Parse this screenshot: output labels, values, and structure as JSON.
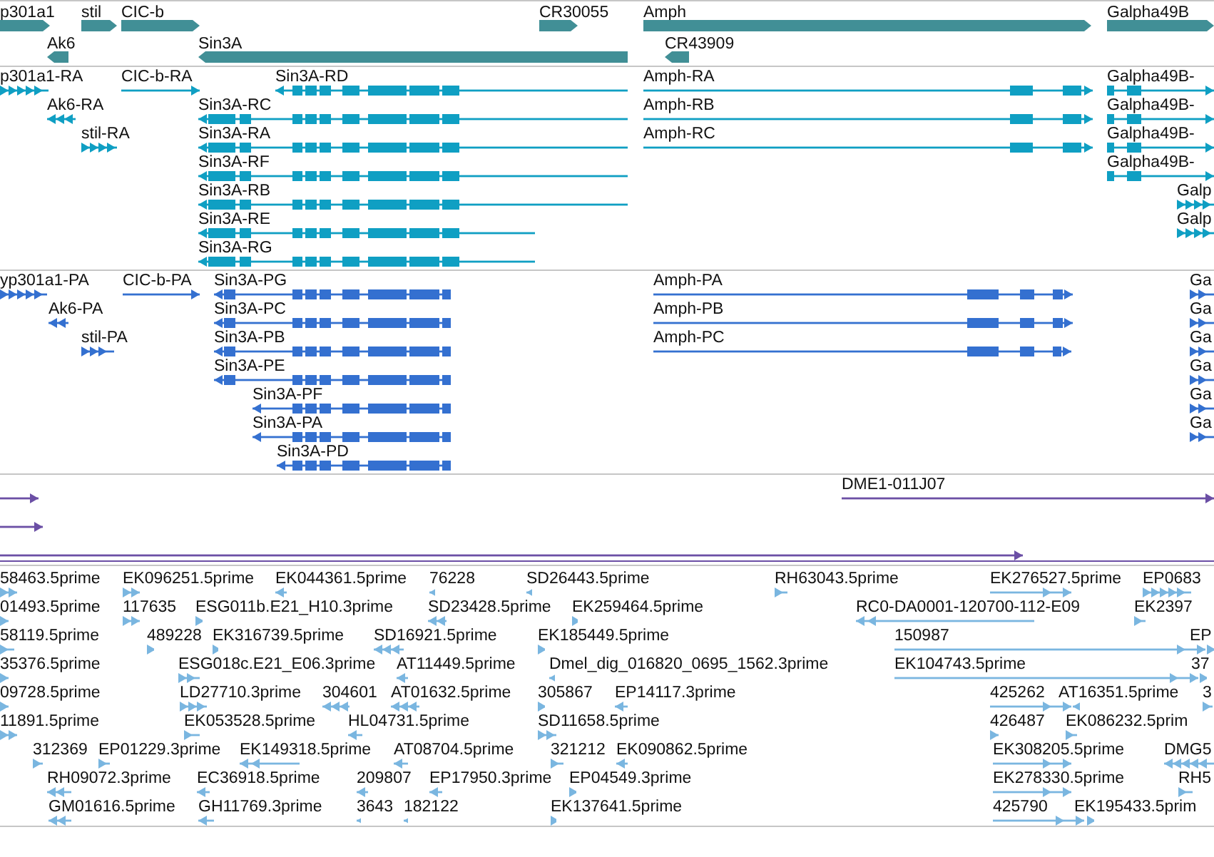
{
  "tracks": [
    {
      "kind": "gene",
      "color": "#418f96",
      "features": [
        {
          "label": "p301a1",
          "reverse": false
        },
        {
          "label": "stil",
          "reverse": false
        },
        {
          "label": "CIC-b",
          "reverse": false
        },
        {
          "label": "CR30055",
          "reverse": false
        },
        {
          "label": "Amph",
          "reverse": false
        },
        {
          "label": "Galpha49B",
          "reverse": false
        },
        {
          "label": "Ak6",
          "reverse": true
        },
        {
          "label": "Sin3A",
          "reverse": true
        },
        {
          "label": "CR43909",
          "reverse": true
        }
      ]
    },
    {
      "kind": "transcript",
      "color": "#0f9fc3",
      "features": [
        {
          "label": "p301a1-RA",
          "reverse": false
        },
        {
          "label": "CIC-b-RA",
          "reverse": false
        },
        {
          "label": "Sin3A-RD",
          "reverse": true
        },
        {
          "label": "Amph-RA",
          "reverse": false
        },
        {
          "label": "Galpha49B-",
          "reverse": false
        },
        {
          "label": "Ak6-RA",
          "reverse": true
        },
        {
          "label": "Sin3A-RC",
          "reverse": true
        },
        {
          "label": "Amph-RB",
          "reverse": false
        },
        {
          "label": "Galpha49B-",
          "reverse": false
        },
        {
          "label": "stil-RA",
          "reverse": false
        },
        {
          "label": "Sin3A-RA",
          "reverse": true
        },
        {
          "label": "Amph-RC",
          "reverse": false
        },
        {
          "label": "Galpha49B-",
          "reverse": false
        },
        {
          "label": "Sin3A-RF",
          "reverse": true
        },
        {
          "label": "Galpha49B-",
          "reverse": false
        },
        {
          "label": "Sin3A-RB",
          "reverse": true
        },
        {
          "label": "Galp",
          "reverse": false
        },
        {
          "label": "Sin3A-RE",
          "reverse": true
        },
        {
          "label": "Galp",
          "reverse": false
        },
        {
          "label": "Sin3A-RG",
          "reverse": true
        }
      ]
    },
    {
      "kind": "protein",
      "color": "#3470d0",
      "features": [
        {
          "label": "yp301a1-PA",
          "reverse": false
        },
        {
          "label": "CIC-b-PA",
          "reverse": false
        },
        {
          "label": "Sin3A-PG",
          "reverse": true
        },
        {
          "label": "Amph-PA",
          "reverse": false
        },
        {
          "label": "Ga",
          "reverse": false
        },
        {
          "label": "Ak6-PA",
          "reverse": true
        },
        {
          "label": "Sin3A-PC",
          "reverse": true
        },
        {
          "label": "Amph-PB",
          "reverse": false
        },
        {
          "label": "Ga",
          "reverse": false
        },
        {
          "label": "stil-PA",
          "reverse": false
        },
        {
          "label": "Sin3A-PB",
          "reverse": true
        },
        {
          "label": "Amph-PC",
          "reverse": false
        },
        {
          "label": "Ga",
          "reverse": false
        },
        {
          "label": "Sin3A-PE",
          "reverse": true
        },
        {
          "label": "Ga",
          "reverse": false
        },
        {
          "label": "Sin3A-PF",
          "reverse": true
        },
        {
          "label": "Ga",
          "reverse": false
        },
        {
          "label": "Sin3A-PA",
          "reverse": true
        },
        {
          "label": "Ga",
          "reverse": false
        },
        {
          "label": "Sin3A-PD",
          "reverse": true
        }
      ]
    },
    {
      "kind": "clone",
      "color": "#6b4fa5",
      "features": [
        {
          "reverse": false
        },
        {
          "label": "DME1-011J07",
          "reverse": false
        },
        {
          "reverse": false
        },
        {
          "reverse": false
        }
      ]
    },
    {
      "kind": "est",
      "color": "#7ab6e0",
      "features": [
        {
          "label": "58463.5prime",
          "reverse": false
        },
        {
          "label": "EK096251.5prime",
          "reverse": false
        },
        {
          "label": "EK044361.5prime",
          "reverse": true
        },
        {
          "label": "76228",
          "reverse": true
        },
        {
          "label": "SD26443.5prime",
          "reverse": true
        },
        {
          "label": "RH63043.5prime",
          "reverse": false
        },
        {
          "label": "EK276527.5prime",
          "reverse": false
        },
        {
          "label": "EP0683",
          "reverse": false
        },
        {
          "label": "01493.5prime",
          "reverse": false
        },
        {
          "label": "117635",
          "reverse": false
        },
        {
          "label": "ESG011b.E21_H10.3prime",
          "reverse": false
        },
        {
          "label": "SD23428.5prime",
          "reverse": true
        },
        {
          "label": "EK259464.5prime",
          "reverse": false
        },
        {
          "label": "RC0-DA0001-120700-112-E09",
          "reverse": true
        },
        {
          "label": "EK2397",
          "reverse": false
        },
        {
          "label": "58119.5prime",
          "reverse": false
        },
        {
          "label": "489228",
          "reverse": false
        },
        {
          "label": "EK316739.5prime",
          "reverse": false
        },
        {
          "label": "SD16921.5prime",
          "reverse": true
        },
        {
          "label": "EK185449.5prime",
          "reverse": false
        },
        {
          "label": "150987",
          "reverse": false
        },
        {
          "label": "EP",
          "reverse": false
        },
        {
          "label": "35376.5prime",
          "reverse": false
        },
        {
          "label": "ESG018c.E21_E06.3prime",
          "reverse": false
        },
        {
          "label": "AT11449.5prime",
          "reverse": true
        },
        {
          "label": "Dmel_dig_016820_0695_1562.3prime",
          "reverse": true
        },
        {
          "label": "EK104743.5prime",
          "reverse": false
        },
        {
          "label": "37",
          "reverse": false
        },
        {
          "label": "09728.5prime",
          "reverse": false
        },
        {
          "label": "LD27710.3prime",
          "reverse": false
        },
        {
          "label": "304601",
          "reverse": true
        },
        {
          "label": "AT01632.5prime",
          "reverse": true
        },
        {
          "label": "305867",
          "reverse": false
        },
        {
          "label": "EP14117.3prime",
          "reverse": true
        },
        {
          "label": "425262",
          "reverse": false
        },
        {
          "label": "AT16351.5prime",
          "reverse": true
        },
        {
          "label": "3",
          "reverse": false
        },
        {
          "label": "11891.5prime",
          "reverse": false
        },
        {
          "label": "EK053528.5prime",
          "reverse": false
        },
        {
          "label": "HL04731.5prime",
          "reverse": true
        },
        {
          "label": "SD11658.5prime",
          "reverse": false
        },
        {
          "label": "426487",
          "reverse": false
        },
        {
          "label": "EK086232.5prim",
          "reverse": false
        },
        {
          "label": "312369",
          "reverse": false
        },
        {
          "label": "EP01229.3prime",
          "reverse": false
        },
        {
          "label": "EK149318.5prime",
          "reverse": true
        },
        {
          "label": "AT08704.5prime",
          "reverse": true
        },
        {
          "label": "321212",
          "reverse": false
        },
        {
          "label": "EK090862.5prime",
          "reverse": true
        },
        {
          "label": "EK308205.5prime",
          "reverse": false
        },
        {
          "label": "DMG5",
          "reverse": true
        },
        {
          "label": "RH09072.3prime",
          "reverse": true
        },
        {
          "label": "EC36918.5prime",
          "reverse": true
        },
        {
          "label": "209807",
          "reverse": true
        },
        {
          "label": "EP17950.3prime",
          "reverse": true
        },
        {
          "label": "EP04549.3prime",
          "reverse": false
        },
        {
          "label": "EK278330.5prime",
          "reverse": false
        },
        {
          "label": "RH5",
          "reverse": false
        },
        {
          "label": "GM01616.5prime",
          "reverse": true
        },
        {
          "label": "GH11769.3prime",
          "reverse": true
        },
        {
          "label": "3643",
          "reverse": true
        },
        {
          "label": "182122",
          "reverse": true
        },
        {
          "label": "EK137641.5prime",
          "reverse": false
        },
        {
          "label": "425790",
          "reverse": false
        },
        {
          "label": "EK195433.5prim",
          "reverse": false
        }
      ]
    }
  ]
}
